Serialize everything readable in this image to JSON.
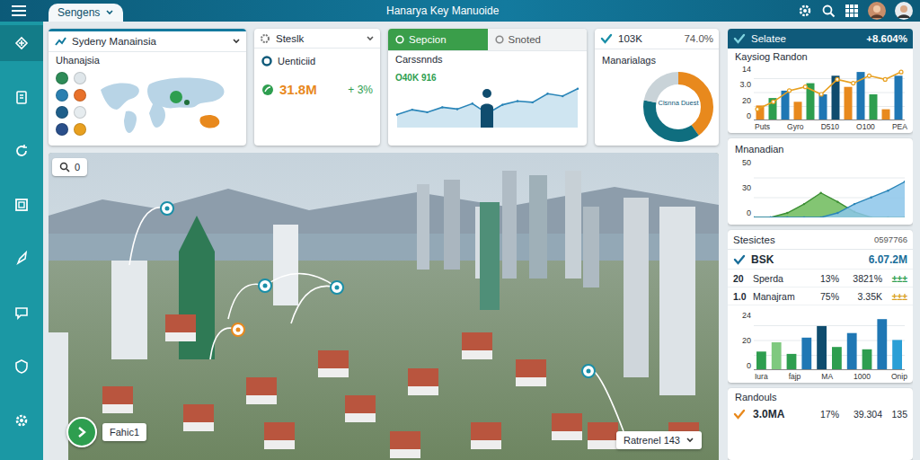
{
  "topbar": {
    "workspace": "Sengens",
    "title": "Hanarya Key Manuoide"
  },
  "sidebar": {
    "items": [
      {
        "selected": true
      },
      {
        "selected": false
      },
      {
        "selected": false
      },
      {
        "selected": false
      },
      {
        "selected": false
      },
      {
        "selected": false
      },
      {
        "selected": false
      },
      {
        "selected": false
      }
    ]
  },
  "region_card": {
    "title": "Sydeny Manainsia",
    "subtitle": "Uhanajsia",
    "markers": [
      {
        "color": "#2e8b57"
      },
      {
        "color": "#dfe6ea"
      },
      {
        "color": "#2a7fb0"
      },
      {
        "color": "#e8712a"
      },
      {
        "color": "#1f5f8a"
      },
      {
        "color": "#e6ecef"
      },
      {
        "color": "#2a4f8a"
      },
      {
        "color": "#e8a020"
      }
    ]
  },
  "stat_card": {
    "title": "Steslk",
    "label": "Uenticiid",
    "value": "31.8M",
    "change": "+ 3%"
  },
  "tabs_card": {
    "tabs": [
      {
        "label": "Sepcion",
        "selected": true
      },
      {
        "label": "Snoted",
        "selected": false
      }
    ],
    "subtitle": "Carssnnds",
    "caption": "O40K 916",
    "series": [
      18,
      26,
      22,
      30,
      27,
      36,
      20,
      34,
      40,
      38,
      52,
      48,
      60
    ]
  },
  "donut_card": {
    "value": "103K",
    "percent": "74.0%",
    "title": "Manarialags",
    "center_label": "Clsnna Duest",
    "segments": [
      {
        "value": 40,
        "color": "#e8891d"
      },
      {
        "value": 38,
        "color": "#0f6e7f"
      },
      {
        "value": 22,
        "color": "#c9d3d8"
      }
    ]
  },
  "sales_card": {
    "title": "Selatee",
    "change": "+8.604%",
    "subtitle": "Kaysiog Randon",
    "y_ticks": [
      "14",
      "3.0",
      "20",
      "0"
    ],
    "x_labels": [
      "Puts",
      "Gyro",
      "D510",
      "O100",
      "PEA"
    ],
    "bars": [
      {
        "value": 4,
        "color": "#e8891d"
      },
      {
        "value": 6,
        "color": "#2e9e4f"
      },
      {
        "value": 8,
        "color": "#1f77b4"
      },
      {
        "value": 5,
        "color": "#e8891d"
      },
      {
        "value": 10,
        "color": "#2e9e4f"
      },
      {
        "value": 7,
        "color": "#1f77b4"
      },
      {
        "value": 12,
        "color": "#0f4c6e"
      },
      {
        "value": 9,
        "color": "#e8891d"
      },
      {
        "value": 13,
        "color": "#1f77b4"
      },
      {
        "value": 7,
        "color": "#2e9e4f"
      },
      {
        "value": 3,
        "color": "#e8891d"
      },
      {
        "value": 12,
        "color": "#1f77b4"
      }
    ],
    "line": [
      3,
      5,
      8,
      9,
      7,
      11,
      10,
      12,
      11,
      13
    ]
  },
  "trend_card": {
    "title": "Mnanadian",
    "y_ticks": [
      "50",
      "30",
      "0"
    ],
    "green_series": [
      0,
      0,
      4,
      12,
      22,
      14,
      5,
      0,
      0,
      0
    ],
    "blue_series": [
      0,
      0,
      0,
      0,
      0,
      4,
      12,
      18,
      24,
      32
    ]
  },
  "stats_card": {
    "title": "Stesictes",
    "code": "0597766",
    "headline": {
      "label": "BSK",
      "value": "6.07.2M"
    },
    "rows": [
      {
        "num": "20",
        "name": "Sperda",
        "pct": "13%",
        "value": "3821%",
        "marks": "±±±",
        "color": "#2e9e4f"
      },
      {
        "num": "1.0",
        "name": "Manajram",
        "pct": "75%",
        "value": "3.35K",
        "marks": "±±±",
        "color": "#d9a020"
      }
    ],
    "y_ticks": [
      "24",
      "20",
      "0"
    ],
    "x_labels": [
      "Iura",
      "fajp",
      "MA",
      "1000",
      "Onip"
    ],
    "bars": [
      {
        "value": 8,
        "color": "#2e9e4f"
      },
      {
        "value": 12,
        "color": "#7fc97f"
      },
      {
        "value": 7,
        "color": "#2e9e4f"
      },
      {
        "value": 14,
        "color": "#1f77b4"
      },
      {
        "value": 19,
        "color": "#0f4c6e"
      },
      {
        "value": 10,
        "color": "#2e9e4f"
      },
      {
        "value": 16,
        "color": "#1f77b4"
      },
      {
        "value": 9,
        "color": "#2e9e4f"
      },
      {
        "value": 22,
        "color": "#1f77b4"
      },
      {
        "value": 13,
        "color": "#2a9fd6"
      }
    ]
  },
  "randouls_card": {
    "title": "Randouls",
    "value": "3.0MA",
    "percent": "17%",
    "count": "39.304",
    "extra": "135"
  },
  "map": {
    "search_value": "0",
    "labels": [
      {
        "text": "Fahic1"
      },
      {
        "text": "Ratrenel 143"
      }
    ]
  }
}
